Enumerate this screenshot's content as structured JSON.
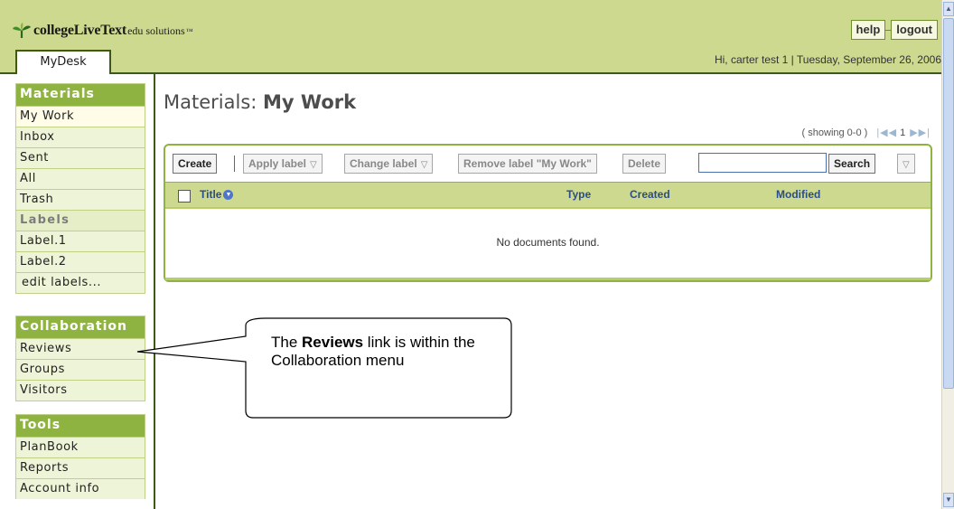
{
  "header": {
    "brand": "collegeLiveText",
    "brand_sub": "edu solutions",
    "brand_tm": "™",
    "help_label": "help",
    "logout_label": "logout",
    "tab_label": "MyDesk",
    "greeting": "Hi, carter test 1  |  Tuesday, September 26, 2006"
  },
  "sidebar": {
    "materials": {
      "title": "Materials",
      "items": [
        "My Work",
        "Inbox",
        "Sent",
        "All",
        "Trash"
      ],
      "labels_heading": "Labels",
      "labels": [
        "Label.1",
        "Label.2"
      ],
      "edit_labels": "edit labels..."
    },
    "collaboration": {
      "title": "Collaboration",
      "items": [
        "Reviews",
        "Groups",
        "Visitors"
      ]
    },
    "tools": {
      "title": "Tools",
      "items": [
        "PlanBook",
        "Reports",
        "Account info"
      ]
    }
  },
  "main": {
    "title_prefix": "Materials: ",
    "title_bold": "My Work",
    "showing": "( showing 0-0 )",
    "page_number": "1",
    "toolbar": {
      "create": "Create",
      "apply_label": "Apply label",
      "change_label": "Change label",
      "remove_label": "Remove label \"My Work\"",
      "delete": "Delete",
      "search_value": "",
      "search": "Search"
    },
    "columns": [
      "Title",
      "Type",
      "Created",
      "Modified"
    ],
    "empty_message": "No documents found."
  },
  "callout": {
    "before": "The ",
    "bold": "Reviews",
    "after": " link is within the Collaboration menu"
  },
  "colors": {
    "header_bg": "#ccd98f",
    "accent_green": "#8fb341",
    "dark_green": "#3c5a14",
    "link_blue": "#2b4c8a"
  }
}
